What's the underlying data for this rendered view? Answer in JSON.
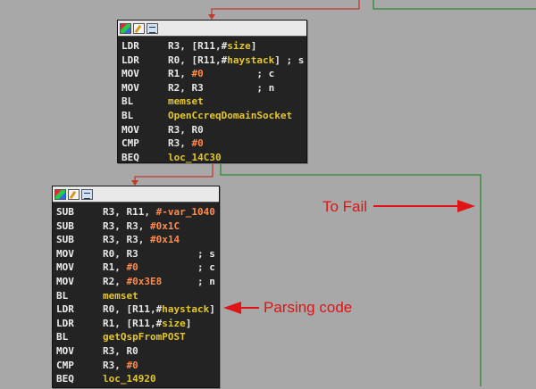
{
  "blocks": [
    {
      "id": "block1",
      "rows": [
        {
          "mn": "LDR",
          "parts": [
            [
              "op",
              "R3, [R11,#"
            ],
            [
              "sym",
              "size"
            ],
            [
              "op",
              "]"
            ]
          ]
        },
        {
          "mn": "LDR",
          "parts": [
            [
              "op",
              "R0, [R11,#"
            ],
            [
              "sym",
              "haystack"
            ],
            [
              "op",
              "] ; s"
            ]
          ]
        },
        {
          "mn": "MOV",
          "parts": [
            [
              "op",
              "R1, "
            ],
            [
              "num",
              "#0"
            ],
            [
              "op",
              "         ; c"
            ]
          ]
        },
        {
          "mn": "MOV",
          "parts": [
            [
              "op",
              "R2, R3"
            ],
            [
              "op",
              "         ; n"
            ]
          ]
        },
        {
          "mn": "BL",
          "parts": [
            [
              "sym",
              "memset"
            ]
          ]
        },
        {
          "mn": "BL",
          "parts": [
            [
              "sym",
              "OpenCcreqDomainSocket"
            ]
          ]
        },
        {
          "mn": "MOV",
          "parts": [
            [
              "op",
              "R3, R0"
            ]
          ]
        },
        {
          "mn": "CMP",
          "parts": [
            [
              "op",
              "R3, "
            ],
            [
              "num",
              "#0"
            ]
          ]
        },
        {
          "mn": "BEQ",
          "parts": [
            [
              "sym",
              "loc_14C30"
            ]
          ]
        }
      ]
    },
    {
      "id": "block2",
      "rows": [
        {
          "mn": "SUB",
          "parts": [
            [
              "op",
              "R3, R11, "
            ],
            [
              "num",
              "#-var_1040"
            ]
          ]
        },
        {
          "mn": "SUB",
          "parts": [
            [
              "op",
              "R3, R3, "
            ],
            [
              "num",
              "#0x1C"
            ]
          ]
        },
        {
          "mn": "SUB",
          "parts": [
            [
              "op",
              "R3, R3, "
            ],
            [
              "num",
              "#0x14"
            ]
          ]
        },
        {
          "mn": "MOV",
          "parts": [
            [
              "op",
              "R0, R3"
            ],
            [
              "op",
              "          ; s"
            ]
          ]
        },
        {
          "mn": "MOV",
          "parts": [
            [
              "op",
              "R1, "
            ],
            [
              "num",
              "#0"
            ],
            [
              "op",
              "          ; c"
            ]
          ]
        },
        {
          "mn": "MOV",
          "parts": [
            [
              "op",
              "R2, "
            ],
            [
              "num",
              "#0x3E8"
            ],
            [
              "op",
              "      ; n"
            ]
          ]
        },
        {
          "mn": "BL",
          "parts": [
            [
              "sym",
              "memset"
            ]
          ]
        },
        {
          "mn": "LDR",
          "parts": [
            [
              "op",
              "R0, [R11,#"
            ],
            [
              "sym",
              "haystack"
            ],
            [
              "op",
              "]"
            ]
          ]
        },
        {
          "mn": "LDR",
          "parts": [
            [
              "op",
              "R1, [R11,#"
            ],
            [
              "sym",
              "size"
            ],
            [
              "op",
              "]"
            ]
          ]
        },
        {
          "mn": "BL",
          "parts": [
            [
              "sym",
              "getQspFromPOST"
            ]
          ]
        },
        {
          "mn": "MOV",
          "parts": [
            [
              "op",
              "R3, R0"
            ]
          ]
        },
        {
          "mn": "CMP",
          "parts": [
            [
              "op",
              "R3, "
            ],
            [
              "num",
              "#0"
            ]
          ]
        },
        {
          "mn": "BEQ",
          "parts": [
            [
              "sym",
              "loc_14920"
            ]
          ]
        }
      ]
    }
  ],
  "annotations": {
    "to_fail": "To Fail",
    "parsing_code": "Parsing code"
  },
  "colors": {
    "background": "#a8a8a8",
    "node_bg": "#232323",
    "true_edge": "#2e8b2e",
    "false_edge": "#c0392b",
    "annotation": "#e01414",
    "symbol": "#e3c72a",
    "immediate": "#ff8a4a"
  },
  "icons": [
    "colors-icon",
    "edit-icon",
    "graph-icon"
  ]
}
